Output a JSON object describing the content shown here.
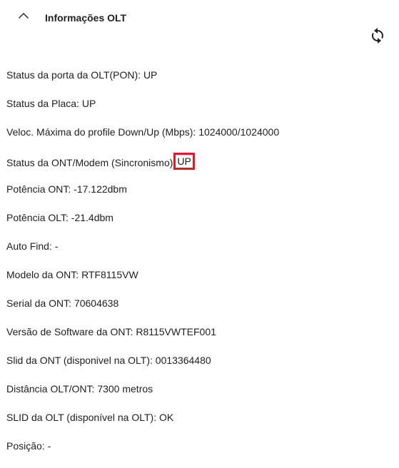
{
  "panel": {
    "title": "Informações OLT",
    "collapse_icon": "chevron-up-icon",
    "refresh_icon": "refresh-icon"
  },
  "rows": [
    {
      "label": "Status da porta da OLT(PON): ",
      "value": "UP"
    },
    {
      "label": "Status da Placa: ",
      "value": "UP"
    },
    {
      "label": "Veloc. Máxima do profile Down/Up (Mbps): ",
      "value": "1024000/1024000"
    },
    {
      "label": "Status da ONT/Modem (Sincronismo)",
      "value": "UP",
      "highlighted": true
    },
    {
      "label": "Potência ONT: ",
      "value": "-17.122dbm"
    },
    {
      "label": "Potência OLT: ",
      "value": "-21.4dbm"
    },
    {
      "label": "Auto Find: ",
      "value": "-"
    },
    {
      "label": "Modelo da ONT: ",
      "value": "RTF8115VW"
    },
    {
      "label": "Serial da ONT: ",
      "value": "70604638"
    },
    {
      "label": "Versão de Software da ONT: ",
      "value": "R8115VWTEF001"
    },
    {
      "label": "Slid da ONT (disponivel na OLT): ",
      "value": "0013364480"
    },
    {
      "label": "Distância OLT/ONT: ",
      "value": "7300 metros"
    },
    {
      "label": "SLID da OLT (disponível na OLT): ",
      "value": "OK"
    },
    {
      "label": "Posição: ",
      "value": "-"
    }
  ],
  "colors": {
    "text": "#212121",
    "highlight_border": "#e01b24",
    "background": "#ffffff"
  }
}
